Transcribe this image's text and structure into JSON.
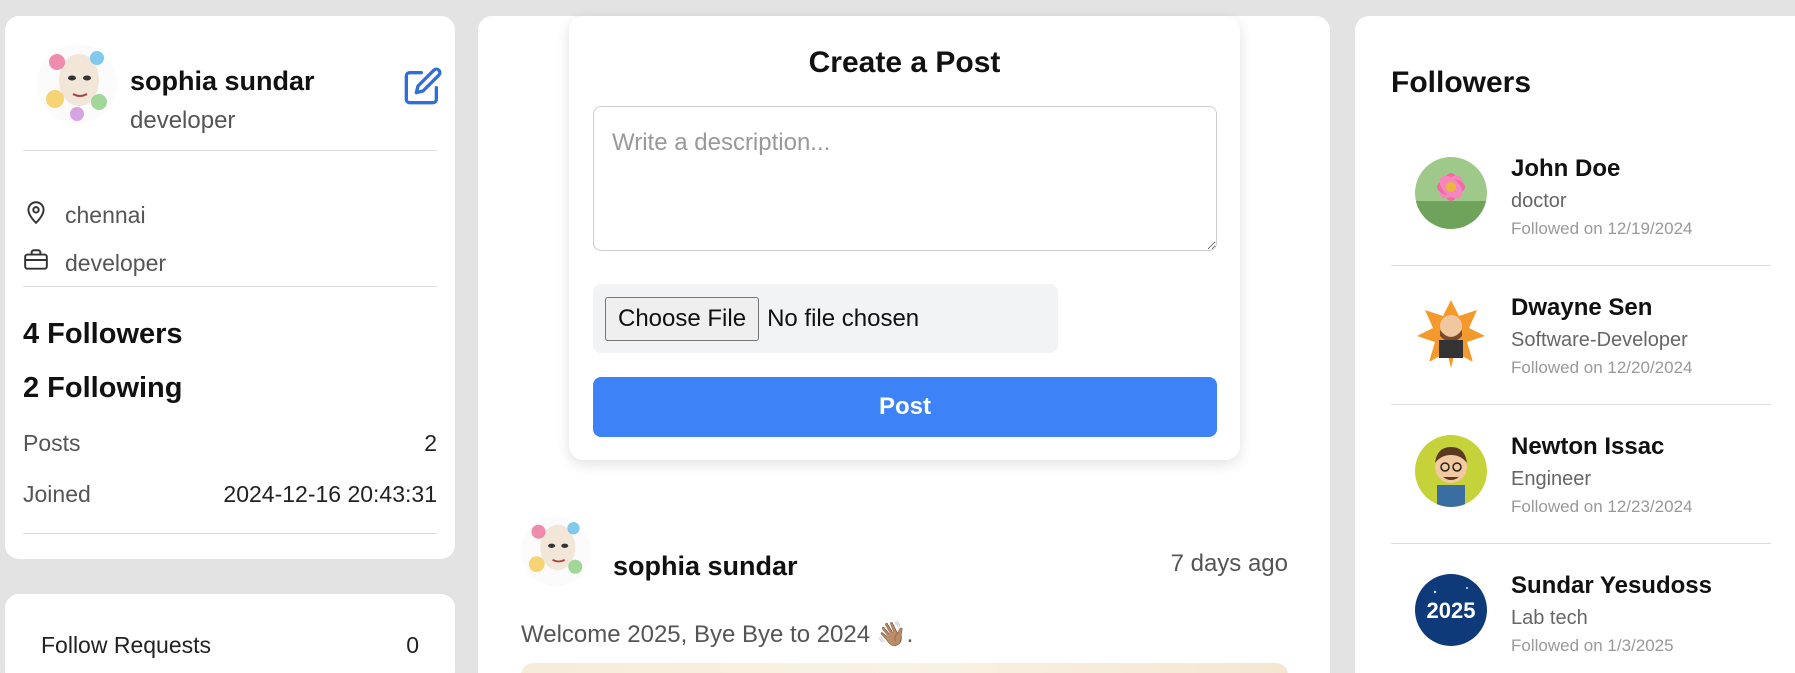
{
  "profile": {
    "name": "sophia sundar",
    "title": "developer",
    "location": "chennai",
    "occupation": "developer",
    "followers_text": "4 Followers",
    "following_text": "2 Following",
    "posts_label": "Posts",
    "posts_value": "2",
    "joined_label": "Joined",
    "joined_value": "2024-12-16 20:43:31"
  },
  "follow_requests": {
    "label": "Follow Requests",
    "count": "0"
  },
  "create_post": {
    "title": "Create a Post",
    "description_placeholder": "Write a description...",
    "choose_file_label": "Choose File",
    "no_file_text": "No file chosen",
    "post_button": "Post"
  },
  "feed": {
    "author": "sophia sundar",
    "time": "7 days ago",
    "text": "Welcome 2025, Bye Bye to 2024 👋🏽."
  },
  "followers_panel": {
    "title": "Followers",
    "items": [
      {
        "name": "John Doe",
        "role": "doctor",
        "followed": "Followed on 12/19/2024"
      },
      {
        "name": "Dwayne Sen",
        "role": "Software-Developer",
        "followed": "Followed on 12/20/2024"
      },
      {
        "name": "Newton Issac",
        "role": "Engineer",
        "followed": "Followed on 12/23/2024"
      },
      {
        "name": "Sundar Yesudoss",
        "role": "Lab tech",
        "followed": "Followed on 1/3/2025"
      }
    ]
  },
  "colors": {
    "accent": "#3d82f6",
    "background": "#e3e3e3",
    "card": "#ffffff"
  }
}
